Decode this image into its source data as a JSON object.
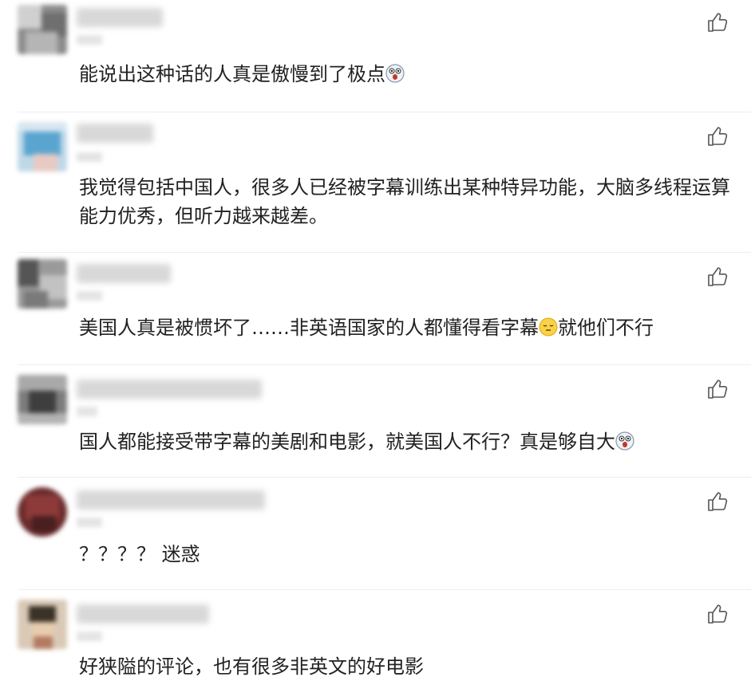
{
  "comments": [
    {
      "text": "能说出这种话的人真是傲慢到了极点",
      "emoji": "shocked-face-icon"
    },
    {
      "text": "我觉得包括中国人，很多人已经被字幕训练出某种特异功能，大脑多线程运算能力优秀，但听力越来越差。",
      "emoji": ""
    },
    {
      "text_before": "美国人真是被惯坏了……非英语国家的人都懂得看字幕",
      "text_after": "就他们不行",
      "emoji": "sleepy-face-icon"
    },
    {
      "text": "国人都能接受带字幕的美剧和电影，就美国人不行？真是够自大",
      "emoji": "shocked-face-icon"
    },
    {
      "text": "？？？？ 迷惑",
      "emoji": ""
    },
    {
      "text": "好狭隘的评论，也有很多非英文的好电影",
      "emoji": ""
    }
  ],
  "like_icon": "thumbs-up-icon"
}
